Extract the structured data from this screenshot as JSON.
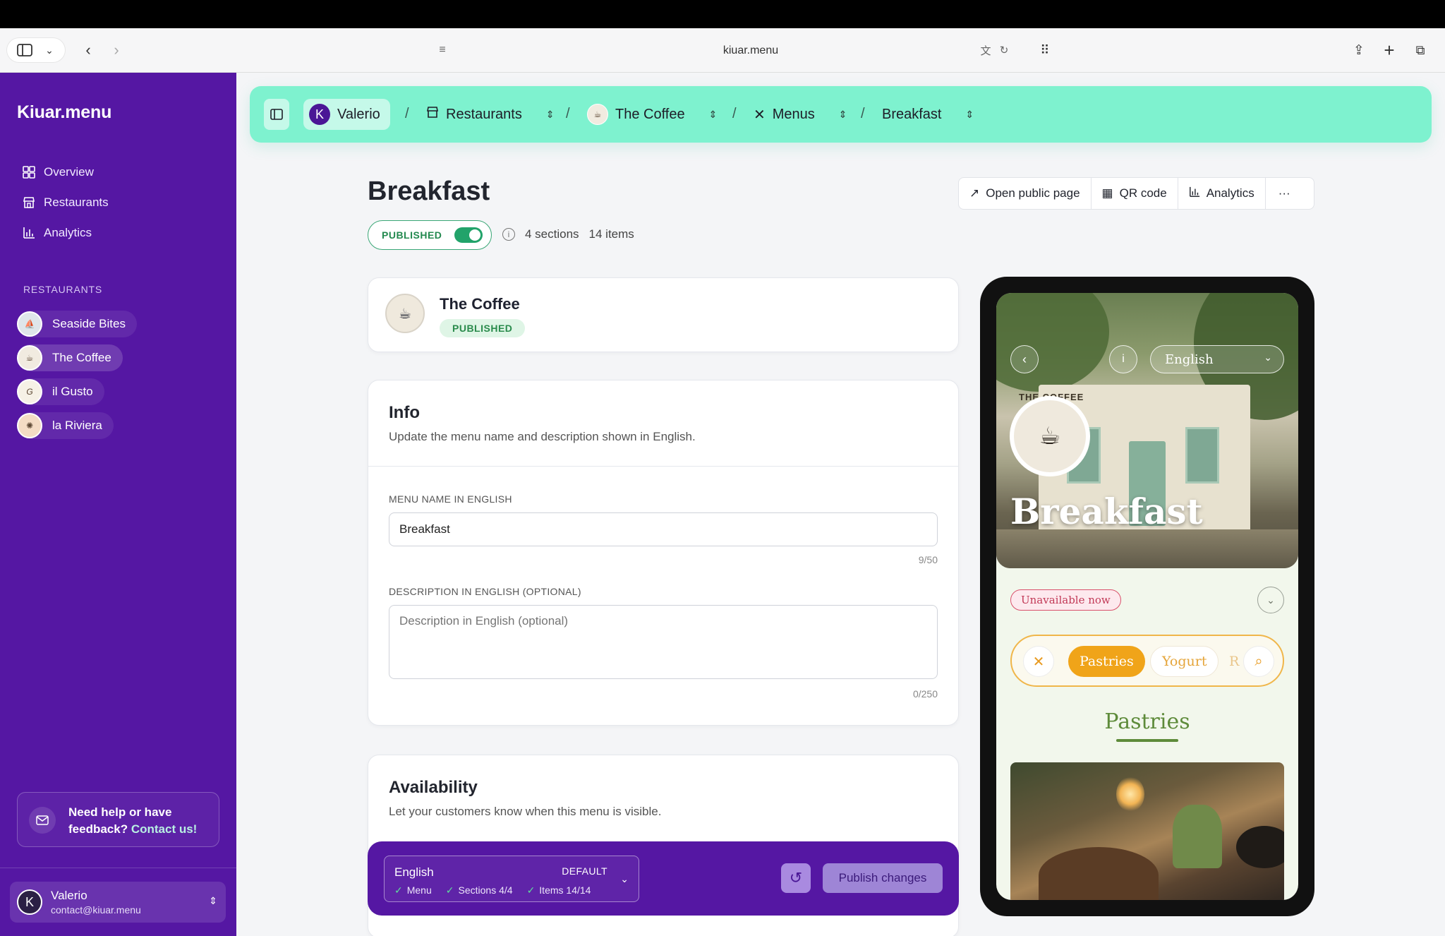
{
  "browser": {
    "url": "kiuar.menu"
  },
  "sidebar": {
    "brand": "Kiuar.menu",
    "nav": [
      {
        "label": "Overview",
        "icon": "grid-icon"
      },
      {
        "label": "Restaurants",
        "icon": "store-icon"
      },
      {
        "label": "Analytics",
        "icon": "bar-chart-icon"
      }
    ],
    "restaurants_heading": "RESTAURANTS",
    "restaurants": [
      {
        "name": "Seaside Bites"
      },
      {
        "name": "The Coffee"
      },
      {
        "name": "il Gusto"
      },
      {
        "name": "la Riviera"
      }
    ],
    "help": {
      "text": "Need help or have feedback?",
      "link": "Contact us!"
    },
    "user": {
      "initial": "K",
      "name": "Valerio",
      "email": "contact@kiuar.menu"
    }
  },
  "breadcrumb": {
    "user_initial": "K",
    "user": "Valerio",
    "restaurants": "Restaurants",
    "restaurant": "The Coffee",
    "menus": "Menus",
    "menu": "Breakfast"
  },
  "header": {
    "title": "Breakfast",
    "status": "PUBLISHED",
    "published": true,
    "sections": "4 sections",
    "items": "14 items",
    "actions": {
      "open_public": "Open public page",
      "qr": "QR code",
      "analytics": "Analytics"
    }
  },
  "restaurant_card": {
    "name": "The Coffee",
    "badge": "PUBLISHED"
  },
  "info": {
    "title": "Info",
    "subtitle": "Update the menu name and description shown in English.",
    "name_label": "MENU NAME IN ENGLISH",
    "name_value": "Breakfast",
    "name_counter": "9/50",
    "desc_label": "DESCRIPTION IN ENGLISH (OPTIONAL)",
    "desc_placeholder": "Description in English (optional)",
    "desc_counter": "0/250"
  },
  "availability": {
    "title": "Availability",
    "subtitle": "Let your customers know when this menu is visible."
  },
  "publish_bar": {
    "language": "English",
    "default_label": "DEFAULT",
    "check_menu": "Menu",
    "check_sections": "Sections 4/4",
    "check_items": "Items 14/14",
    "publish_label": "Publish changes"
  },
  "preview": {
    "language": "English",
    "title": "Breakfast",
    "sign": "THE COFFEE",
    "unavailable": "Unavailable now",
    "categories": [
      "Pastries",
      "Yogurt",
      "R"
    ],
    "section_title": "Pastries"
  }
}
